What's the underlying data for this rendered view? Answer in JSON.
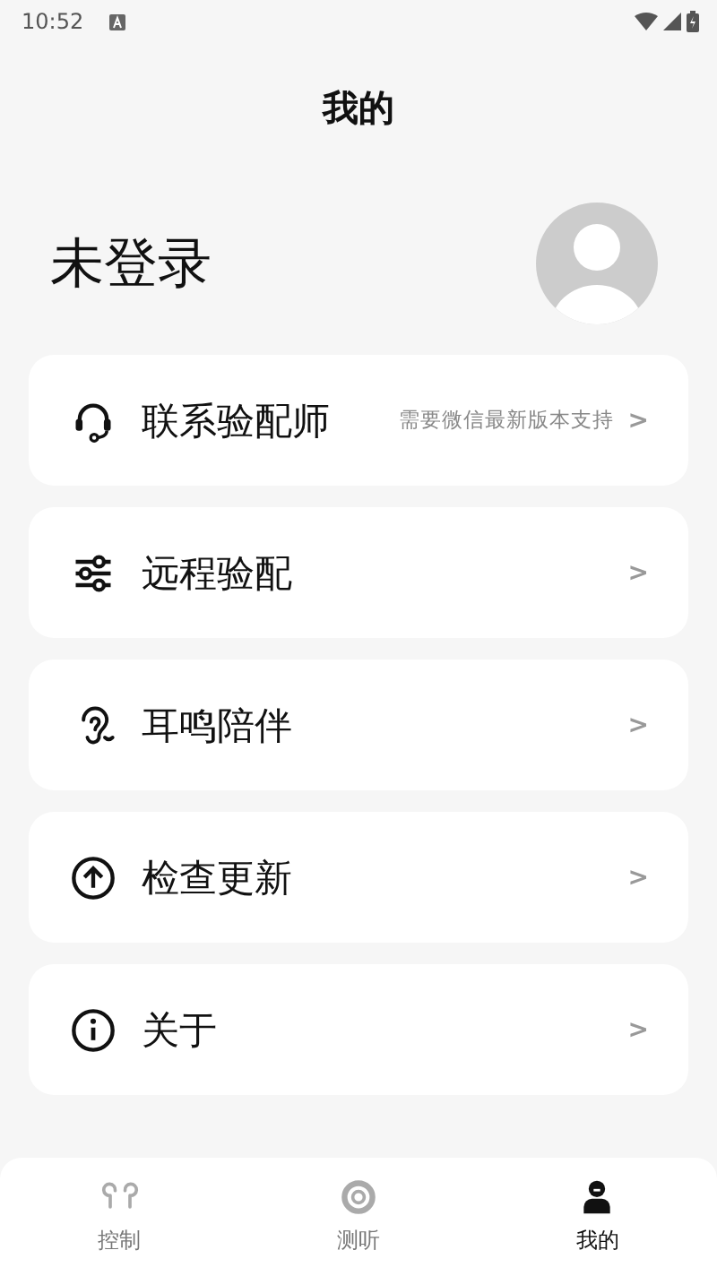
{
  "status_bar": {
    "time": "10:52"
  },
  "header": {
    "title": "我的"
  },
  "profile": {
    "name": "未登录"
  },
  "menu": [
    {
      "label": "联系验配师",
      "note": "需要微信最新版本支持",
      "chevron": ">"
    },
    {
      "label": "远程验配",
      "chevron": ">"
    },
    {
      "label": "耳鸣陪伴",
      "chevron": ">"
    },
    {
      "label": "检查更新",
      "chevron": ">"
    },
    {
      "label": "关于",
      "chevron": ">"
    }
  ],
  "tab_bar": [
    {
      "label": "控制",
      "selected": false
    },
    {
      "label": "测听",
      "selected": false
    },
    {
      "label": "我的",
      "selected": true
    }
  ]
}
